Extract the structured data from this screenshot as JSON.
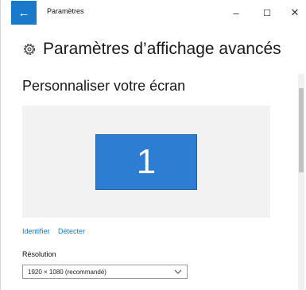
{
  "window": {
    "title": "Paramètres",
    "back_glyph": "←",
    "controls": {
      "minimize": "–",
      "maximize": "☐",
      "close": "✕"
    }
  },
  "header": {
    "icon": "gear-icon",
    "title": "Paramètres d’affichage avancés"
  },
  "main": {
    "section_title": "Personnaliser votre écran",
    "display_number": "1",
    "links": {
      "identify": "Identifier",
      "detect": "Détecter"
    },
    "resolution": {
      "label": "Résolution",
      "selected": "1920 × 1080 (recommandé)",
      "chevron_icon": "chevron-down-icon"
    }
  },
  "colors": {
    "accent": "#1979ca",
    "monitor": "#2d7dd2",
    "display_area_bg": "#f2f2f2"
  }
}
